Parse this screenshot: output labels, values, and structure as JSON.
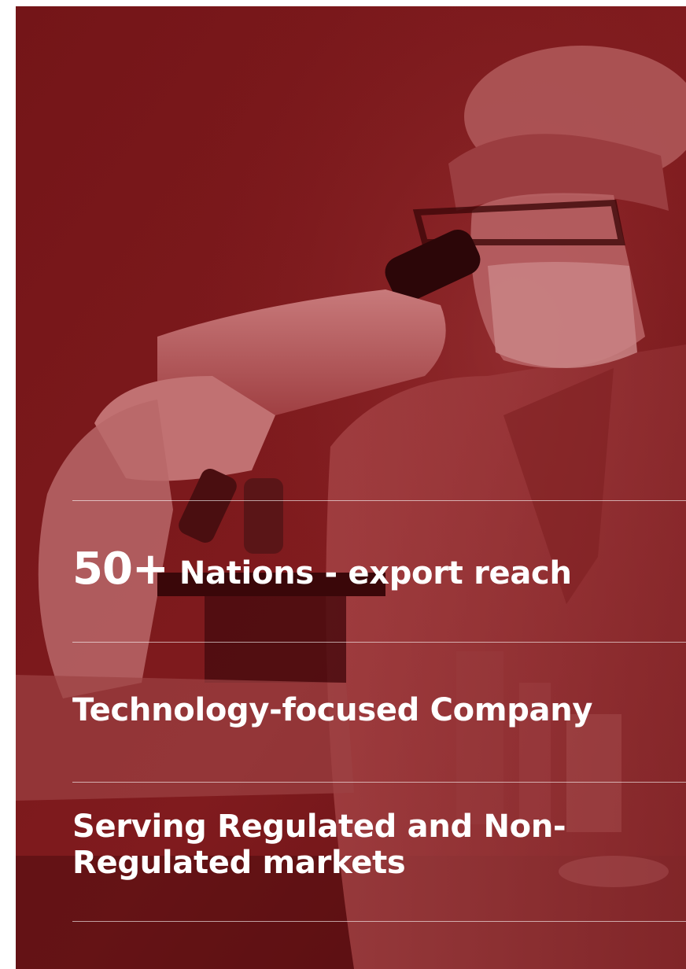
{
  "hero": {
    "background_color": "#6f1316",
    "image_subject": "scientist-with-microscope"
  },
  "stats": [
    {
      "number": "50+",
      "text": "Nations - export reach"
    },
    {
      "text": "Technology-focused Company"
    },
    {
      "text": "Serving Regulated and Non-Regulated markets"
    }
  ]
}
